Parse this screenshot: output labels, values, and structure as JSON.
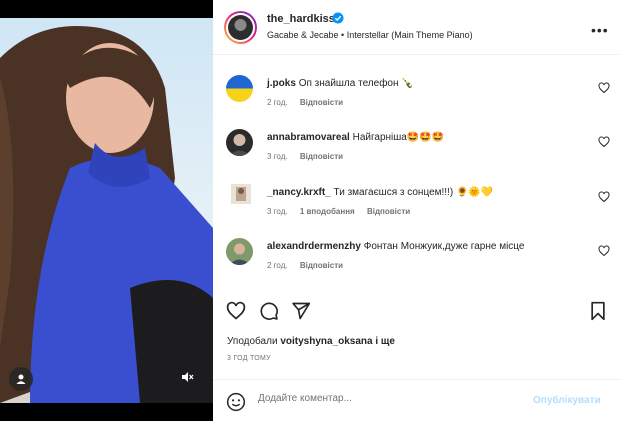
{
  "post": {
    "author": "the_hardkiss",
    "audio": "Gacabe & Jecabe • Interstellar (Main Theme Piano)",
    "more_label": "•••"
  },
  "comments": [
    {
      "user": "j.poks",
      "text": "Оп знайшла телефон 🍾",
      "time": "2 год.",
      "reply": "Відповісти"
    },
    {
      "user": "annabramovareal",
      "text": "Найгарніша🤩🤩🤩",
      "time": "3 год.",
      "reply": "Відповісти"
    },
    {
      "user": "_nancy.krxft_",
      "text": "Ти змагаєшся з сонцем!!!) 🌻🌞💛",
      "time": "3 год.",
      "likes": "1 вподобання",
      "reply": "Відповісти"
    },
    {
      "user": "alexandrdermenzhy",
      "text": "Фонтан Монжуик,дуже гарне місце",
      "time": "2 год.",
      "reply": "Відповісти"
    }
  ],
  "likes": {
    "prefix": "Уподобали",
    "user": "voityshyna_oksana",
    "suffix": "і ще"
  },
  "timestamp": "3 ГОД ТОМУ",
  "composer": {
    "placeholder": "Додайте коментар...",
    "publish": "Опублікувати"
  },
  "colors": {
    "accent": "#0095f6",
    "publish_disabled": "#b2dffc",
    "verified": "#0095f6"
  }
}
